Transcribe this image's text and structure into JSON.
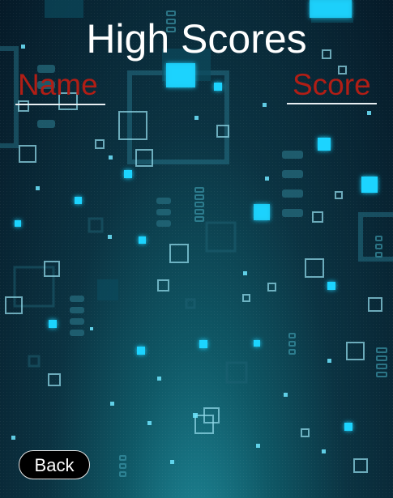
{
  "screen": {
    "title": "High Scores",
    "columns": {
      "name": "Name",
      "score": "Score"
    },
    "back_label": "Back"
  },
  "colors": {
    "title": "#ffffff",
    "column_header": "#b01e16",
    "button_bg": "#000000",
    "glow": "#1ed4ff"
  }
}
